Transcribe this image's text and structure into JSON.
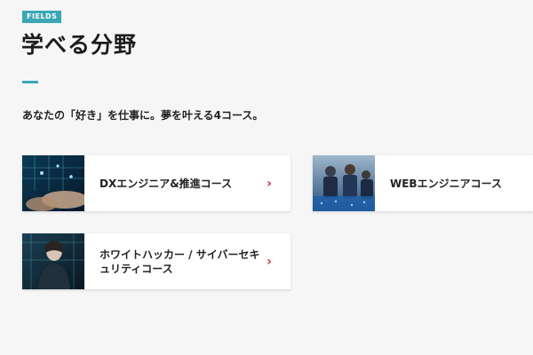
{
  "section": {
    "badge": "FIELDS",
    "title": "学べる分野",
    "lead": "あなたの「好き」を仕事に。夢を叶える4コース。"
  },
  "colors": {
    "accent": "#3aa7b4",
    "chevron": "#d1283a",
    "background": "#f6f6f6"
  },
  "courses": [
    {
      "label": "DXエンジニア&推進コース",
      "icon": "chevron-right-icon"
    },
    {
      "label": "WEBエンジニアコース",
      "icon": "chevron-right-icon"
    },
    {
      "label": "ホワイトハッカー / サイバーセキュリティコース",
      "icon": "chevron-right-icon"
    }
  ]
}
